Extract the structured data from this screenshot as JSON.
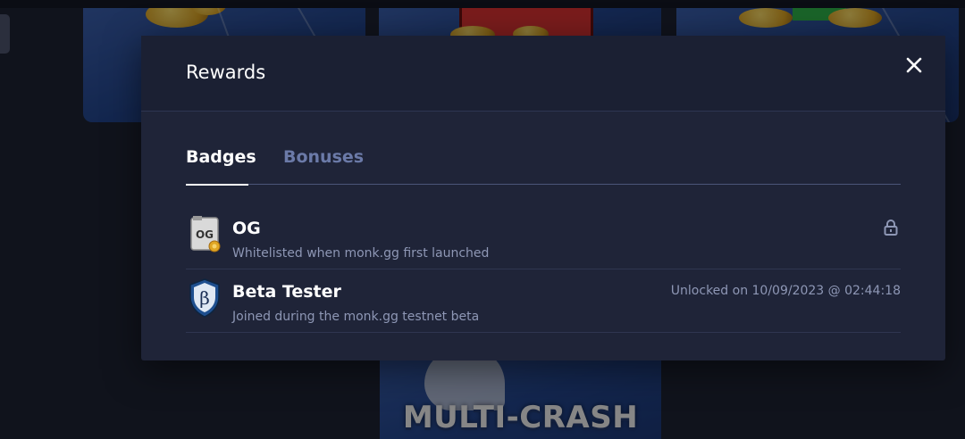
{
  "background": {
    "cards": [
      {
        "name": "game-card-1"
      },
      {
        "name": "game-card-2"
      },
      {
        "name": "game-card-3"
      },
      {
        "name": "game-card-multi-crash",
        "title": "MULTI-CRASH"
      }
    ]
  },
  "modal": {
    "title": "Rewards",
    "close_icon": "close-icon",
    "tabs": [
      {
        "label": "Badges",
        "active": true
      },
      {
        "label": "Bonuses",
        "active": false
      }
    ],
    "badges": [
      {
        "name": "OG",
        "description": "Whitelisted when monk.gg first launched",
        "icon": "og-badge-icon",
        "status": "locked",
        "status_icon": "lock-icon"
      },
      {
        "name": "Beta Tester",
        "description": "Joined during the monk.gg testnet beta",
        "icon": "beta-shield-icon",
        "status": "Unlocked on 10/09/2023 @ 02:44:18"
      }
    ]
  },
  "colors": {
    "modal_bg": "#1f2438",
    "active_tab": "#ffffff",
    "inactive_tab": "#6b7aa8",
    "muted_text": "#8e97b5"
  }
}
